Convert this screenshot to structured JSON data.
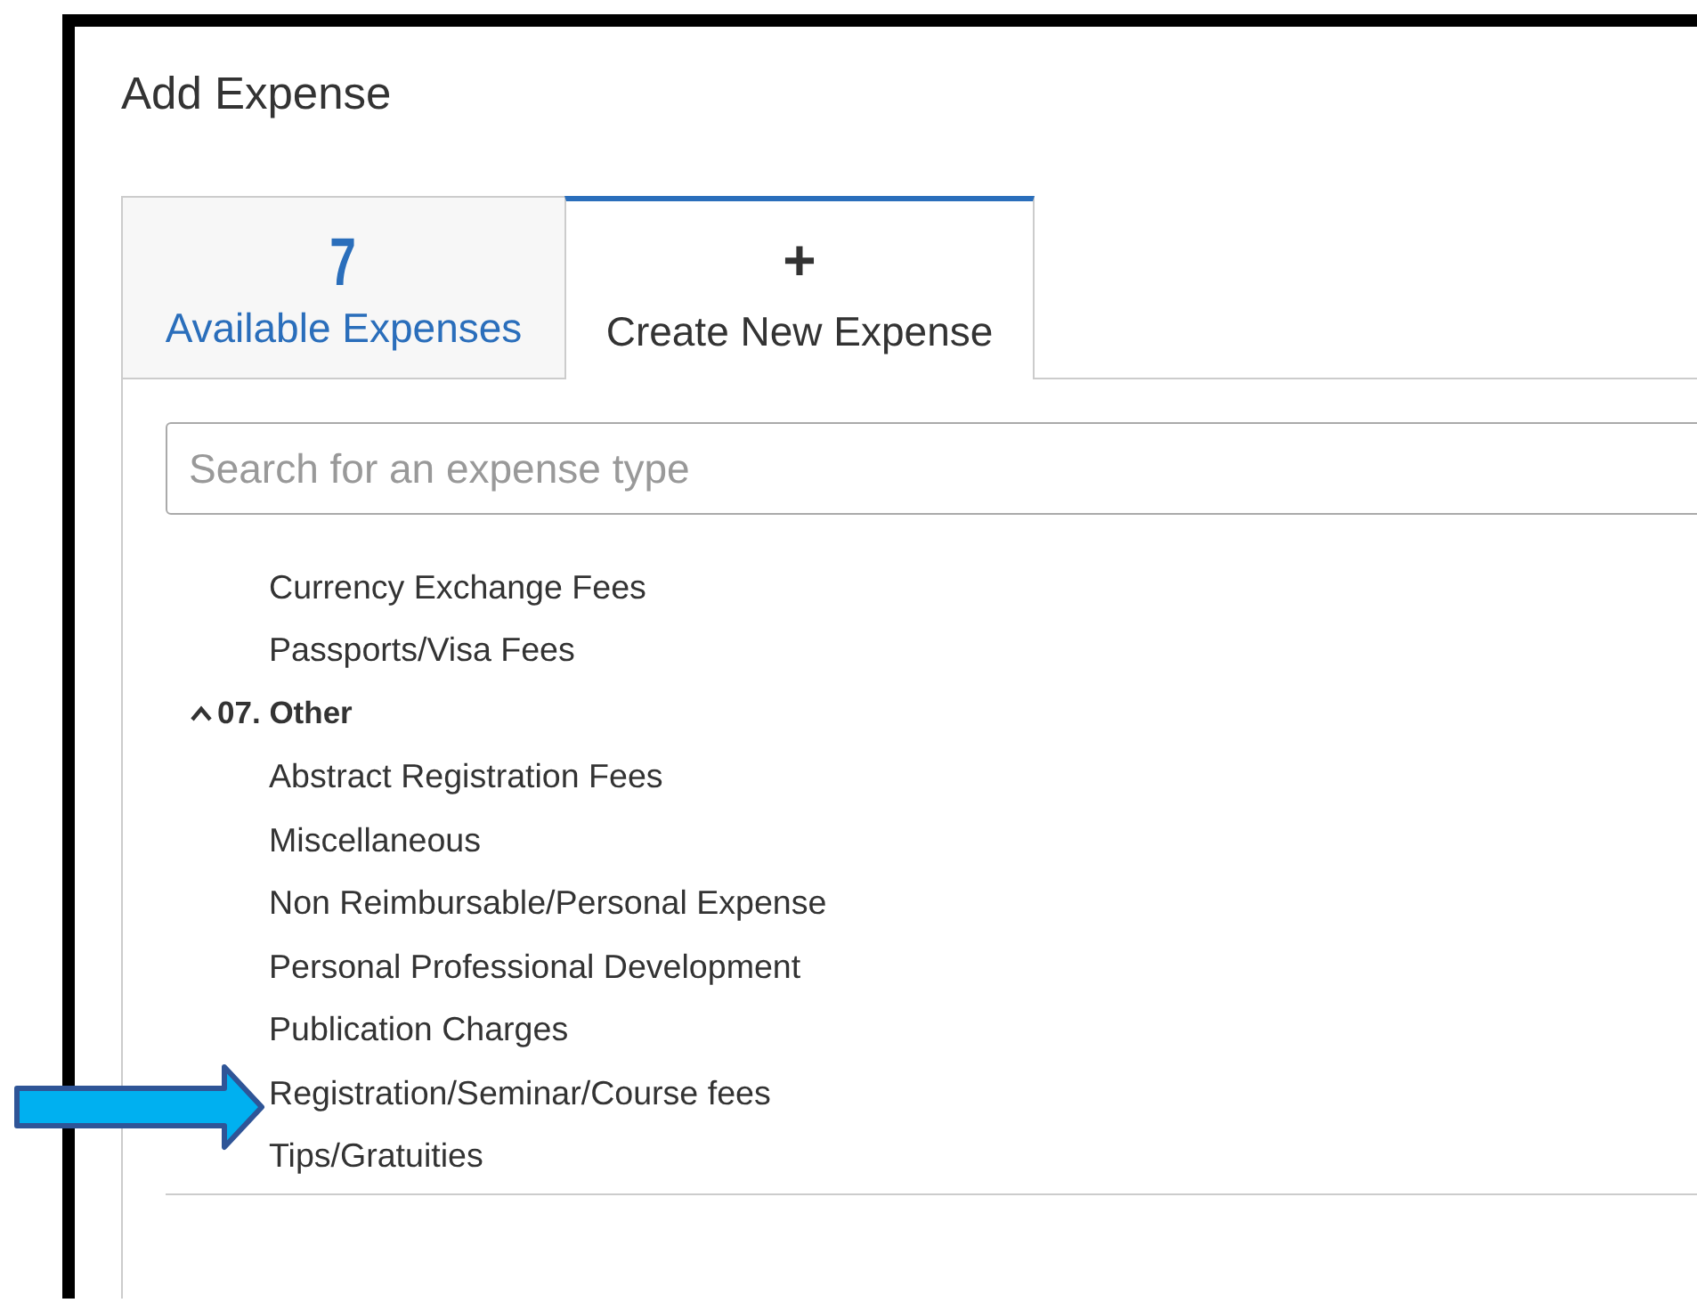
{
  "dialog": {
    "title": "Add Expense"
  },
  "tabs": [
    {
      "kind": "count",
      "count": "7",
      "label": "Available Expenses",
      "selected": false
    },
    {
      "kind": "create",
      "icon": "+",
      "label": "Create New Expense",
      "selected": true
    }
  ],
  "search": {
    "placeholder": "Search for an expense type"
  },
  "expense_types": [
    {
      "kind": "item",
      "label": "Currency Exchange Fees",
      "pointed": false
    },
    {
      "kind": "item",
      "label": "Passports/Visa Fees",
      "pointed": false
    },
    {
      "kind": "group",
      "label": "07. Other",
      "expanded": true,
      "children": [
        {
          "kind": "item",
          "label": "Abstract Registration Fees",
          "pointed": false
        },
        {
          "kind": "item",
          "label": "Miscellaneous",
          "pointed": false
        },
        {
          "kind": "item",
          "label": "Non Reimbursable/Personal Expense",
          "pointed": false
        },
        {
          "kind": "item",
          "label": "Personal Professional Development",
          "pointed": false
        },
        {
          "kind": "item",
          "label": "Publication Charges",
          "pointed": false
        },
        {
          "kind": "item",
          "label": "Registration/Seminar/Course fees",
          "pointed": true
        },
        {
          "kind": "item",
          "label": "Tips/Gratuities",
          "pointed": false
        }
      ]
    }
  ]
}
